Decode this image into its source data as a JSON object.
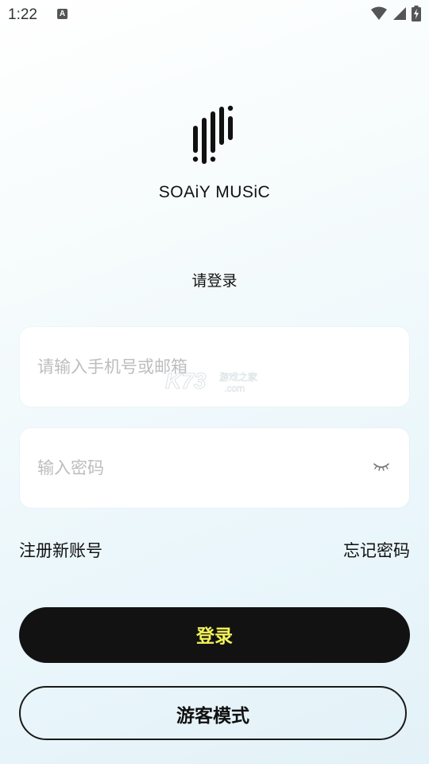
{
  "status_bar": {
    "time": "1:22",
    "indicator": "A",
    "icons": [
      "wifi-icon",
      "signal-icon",
      "battery-charging-icon"
    ]
  },
  "brand": {
    "name": "SOAiY MUSiC"
  },
  "login": {
    "prompt": "请登录",
    "phone_placeholder": "请输入手机号或邮箱",
    "password_placeholder": "输入密码",
    "register_link": "注册新账号",
    "forgot_link": "忘记密码",
    "login_button": "登录",
    "guest_button": "游客模式"
  },
  "watermark": {
    "logo_text": "K73",
    "site_name": "游戏之家",
    "domain": ".com"
  },
  "colors": {
    "accent_text": "#f2f25a",
    "button_bg": "#121212"
  }
}
